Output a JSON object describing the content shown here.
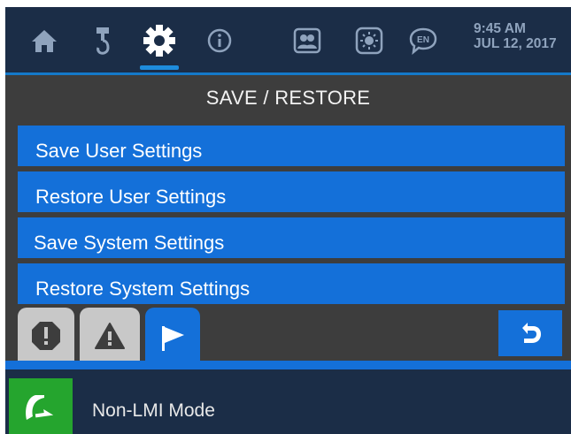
{
  "header": {
    "icons": [
      {
        "name": "home-icon"
      },
      {
        "name": "crane-hook-icon"
      },
      {
        "name": "gear-icon",
        "active": true
      },
      {
        "name": "info-icon"
      },
      {
        "name": "operators-icon"
      },
      {
        "name": "brightness-icon"
      },
      {
        "name": "language-icon",
        "label": "EN"
      }
    ],
    "time": "9:45 AM",
    "date": "JUL 12, 2017"
  },
  "page": {
    "title": "SAVE / RESTORE"
  },
  "menu": {
    "items": [
      {
        "label": "Save User Settings"
      },
      {
        "label": "Restore User Settings"
      },
      {
        "label": "Save System Settings"
      },
      {
        "label": "Restore System Settings"
      }
    ]
  },
  "tabs": [
    {
      "name": "faults-tab-icon"
    },
    {
      "name": "warnings-tab-icon"
    },
    {
      "name": "flag-tab-icon",
      "active": true
    }
  ],
  "status": {
    "mode_text": "Non-LMI Mode",
    "mode_icon": "non-lmi-arrow-icon",
    "mode_color": "#25a52e"
  },
  "colors": {
    "accent": "#1470d9",
    "header_bg": "#1b2d47",
    "body_bg": "#3d3d3d"
  }
}
